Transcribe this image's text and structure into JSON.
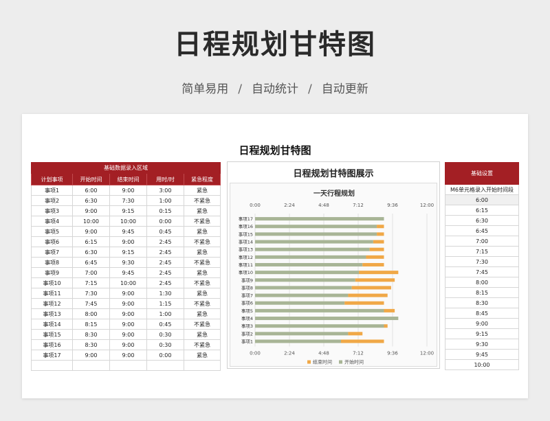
{
  "hero": {
    "title": "日程规划甘特图",
    "tags": [
      "简单易用",
      "自动统计",
      "自动更新"
    ],
    "separator": "/"
  },
  "sheet": {
    "title": "日程规划甘特图"
  },
  "table": {
    "band": "基础数据录入区域",
    "headers": [
      "计划事项",
      "开始时间",
      "结束时间",
      "用时/时",
      "紧急程度"
    ],
    "rows": [
      [
        "事项1",
        "6:00",
        "9:00",
        "3:00",
        "紧急"
      ],
      [
        "事项2",
        "6:30",
        "7:30",
        "1:00",
        "不紧急"
      ],
      [
        "事项3",
        "9:00",
        "9:15",
        "0:15",
        "紧急"
      ],
      [
        "事项4",
        "10:00",
        "10:00",
        "0:00",
        "不紧急"
      ],
      [
        "事项5",
        "9:00",
        "9:45",
        "0:45",
        "紧急"
      ],
      [
        "事项6",
        "6:15",
        "9:00",
        "2:45",
        "不紧急"
      ],
      [
        "事项7",
        "6:30",
        "9:15",
        "2:45",
        "紧急"
      ],
      [
        "事项8",
        "6:45",
        "9:30",
        "2:45",
        "不紧急"
      ],
      [
        "事项9",
        "7:00",
        "9:45",
        "2:45",
        "紧急"
      ],
      [
        "事项10",
        "7:15",
        "10:00",
        "2:45",
        "不紧急"
      ],
      [
        "事项11",
        "7:30",
        "9:00",
        "1:30",
        "紧急"
      ],
      [
        "事项12",
        "7:45",
        "9:00",
        "1:15",
        "不紧急"
      ],
      [
        "事项13",
        "8:00",
        "9:00",
        "1:00",
        "紧急"
      ],
      [
        "事项14",
        "8:15",
        "9:00",
        "0:45",
        "不紧急"
      ],
      [
        "事项15",
        "8:30",
        "9:00",
        "0:30",
        "紧急"
      ],
      [
        "事项16",
        "8:30",
        "9:00",
        "0:30",
        "不紧急"
      ],
      [
        "事项17",
        "9:00",
        "9:00",
        "0:00",
        "紧急"
      ]
    ]
  },
  "chart_panel": {
    "title": "日程规划甘特图展示"
  },
  "chart_data": {
    "type": "bar",
    "orientation": "horizontal-stacked",
    "title": "一天行程规划",
    "x_ticks": [
      "0:00",
      "2:24",
      "4:48",
      "7:12",
      "9:36",
      "12:00"
    ],
    "xlim": [
      0,
      12
    ],
    "categories": [
      "事项17",
      "事项16",
      "事项15",
      "事项14",
      "事项13",
      "事项12",
      "事项11",
      "事项10",
      "事项9",
      "事项8",
      "事项7",
      "事项6",
      "事项5",
      "事项4",
      "事项3",
      "事项2",
      "事项1"
    ],
    "series": [
      {
        "name": "开始时间",
        "values": [
          9.0,
          8.5,
          8.5,
          8.25,
          8.0,
          7.75,
          7.5,
          7.25,
          7.0,
          6.75,
          6.5,
          6.25,
          9.0,
          10.0,
          9.0,
          6.5,
          6.0
        ]
      },
      {
        "name": "结束时间",
        "values": [
          9.0,
          9.0,
          9.0,
          9.0,
          9.0,
          9.0,
          9.0,
          10.0,
          9.75,
          9.5,
          9.25,
          9.0,
          9.75,
          10.0,
          9.25,
          7.5,
          9.0
        ]
      }
    ],
    "legend_position": "bottom",
    "grid": true,
    "colors": {
      "开始时间": "#a8b596",
      "结束时间": "#f0a847"
    }
  },
  "settings": {
    "title": "基础设置",
    "label": "M6单元格录入开始时间段",
    "times": [
      "6:00",
      "6:15",
      "6:30",
      "6:45",
      "7:00",
      "7:15",
      "7:30",
      "7:45",
      "8:00",
      "8:15",
      "8:30",
      "8:45",
      "9:00",
      "9:15",
      "9:30",
      "9:45",
      "10:00"
    ]
  }
}
